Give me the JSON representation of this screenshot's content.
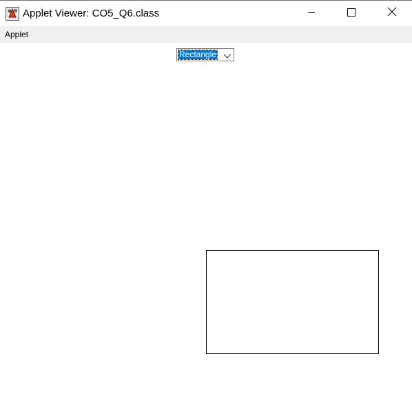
{
  "window": {
    "title": "Applet Viewer: CO5_Q6.class",
    "icon": "java-applet-icon",
    "controls": {
      "minimize_icon": "minimize-icon",
      "maximize_icon": "maximize-icon",
      "close_icon": "close-icon"
    }
  },
  "menubar": {
    "items": [
      {
        "label": "Applet"
      }
    ]
  },
  "applet": {
    "shape_choice": {
      "selected": "Rectangle",
      "icon": "chevron-down-icon",
      "highlight_color": "#0078d7"
    },
    "canvas": {
      "drawn_shape": "rectangle",
      "stroke_color": "#000000"
    }
  }
}
